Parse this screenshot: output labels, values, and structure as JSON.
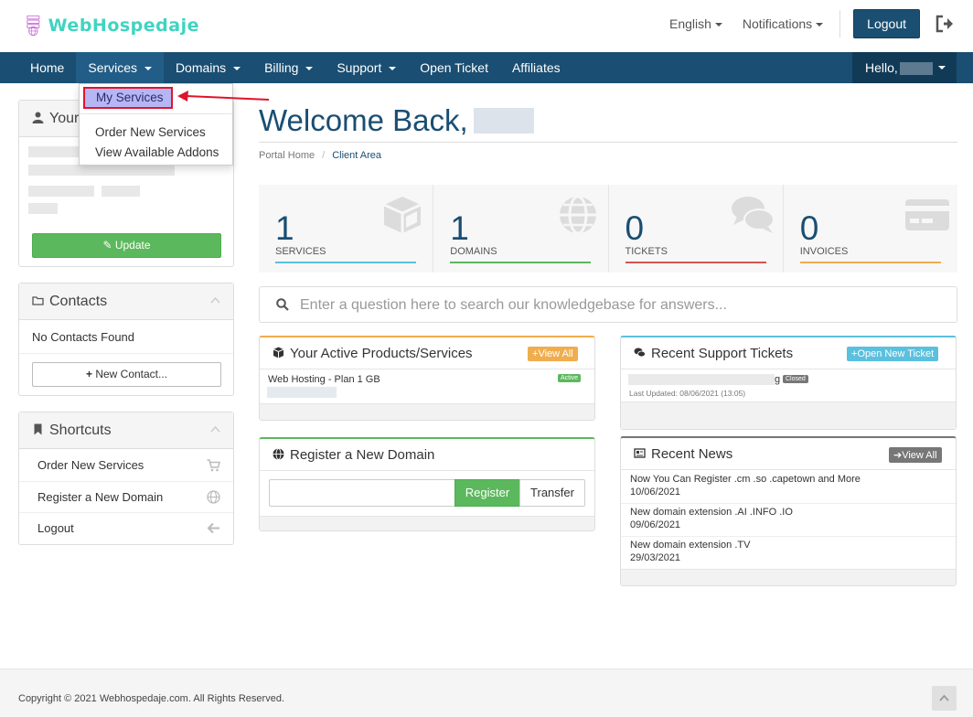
{
  "brand": {
    "name": "WebHospedaje",
    "color": "#3fd4c0"
  },
  "topbar": {
    "language": "English",
    "notifications": "Notifications",
    "logout": "Logout"
  },
  "nav": {
    "items": [
      "Home",
      "Services",
      "Domains",
      "Billing",
      "Support",
      "Open Ticket",
      "Affiliates"
    ],
    "hello": "Hello,"
  },
  "services_dropdown": {
    "my_services": "My Services",
    "order_new": "Order New Services",
    "view_addons": "View Available Addons"
  },
  "sidebar": {
    "your_info_title": "Your",
    "update_button": "Update",
    "contacts_title": "Contacts",
    "no_contacts": "No Contacts Found",
    "new_contact_button": "New Contact...",
    "shortcuts_title": "Shortcuts",
    "shortcuts": [
      "Order New Services",
      "Register a New Domain",
      "Logout"
    ]
  },
  "main": {
    "welcome": "Welcome Back,",
    "breadcrumb": [
      "Portal Home",
      "Client Area"
    ],
    "stats": [
      {
        "value": "1",
        "label": "Services",
        "color": "#5bc0de"
      },
      {
        "value": "1",
        "label": "Domains",
        "color": "#5cb85c"
      },
      {
        "value": "0",
        "label": "Tickets",
        "color": "#d9534f"
      },
      {
        "value": "0",
        "label": "Invoices",
        "color": "#f0ad4e"
      }
    ],
    "kb_placeholder": "Enter a question here to search our knowledgebase for answers..."
  },
  "products_card": {
    "title": "Your Active Products/Services",
    "view_all": "View All",
    "product_name": "Web Hosting - Plan 1 GB",
    "status": "Active"
  },
  "tickets_card": {
    "title": "Recent Support Tickets",
    "open_new": "Open New Ticket",
    "ticket_suffix": "g",
    "status": "Closed",
    "last_updated": "Last Updated: 08/06/2021 (13:05)"
  },
  "domain_card": {
    "title": "Register a New Domain",
    "register": "Register",
    "transfer": "Transfer"
  },
  "news_card": {
    "title": "Recent News",
    "view_all": "View All",
    "items": [
      {
        "title": "Now You Can Register .cm .so .capetown and More",
        "date": "10/06/2021"
      },
      {
        "title": "New domain extension .AI .INFO .IO",
        "date": "09/06/2021"
      },
      {
        "title": "New domain extension .TV",
        "date": "29/03/2021"
      }
    ]
  },
  "footer": {
    "copyright": "Copyright © 2021 Webhospedaje.com. All Rights Reserved."
  }
}
